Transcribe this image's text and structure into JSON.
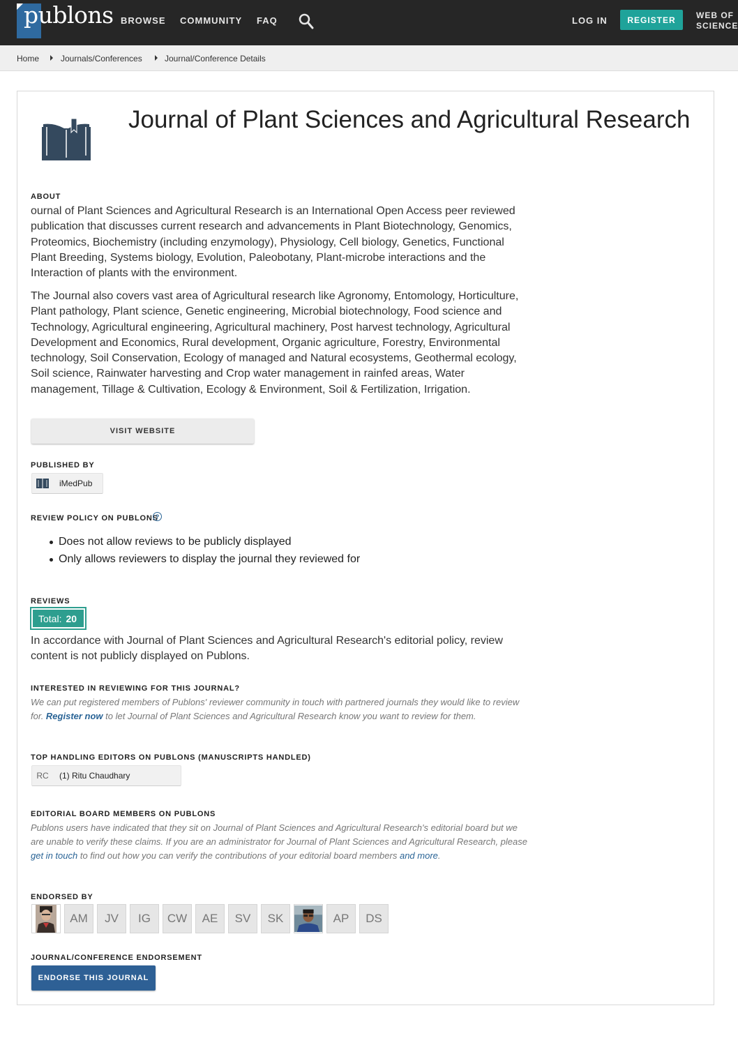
{
  "nav": {
    "logo": "publons",
    "browse": "BROWSE",
    "community": "COMMUNITY",
    "faq": "FAQ",
    "login": "LOG IN",
    "register": "REGISTER",
    "wos_line1": "WEB OF",
    "wos_line2": "SCIENCE"
  },
  "breadcrumb": {
    "home": "Home",
    "journals": "Journals/Conferences",
    "current": "Journal/Conference Details"
  },
  "journal": {
    "title": "Journal of Plant Sciences and Agricultural Research"
  },
  "about": {
    "label": "ABOUT",
    "para1": "ournal of Plant Sciences and Agricultural Research is an International Open Access peer reviewed publication that discusses current research and advancements in Plant Biotechnology, Genomics, Proteomics, Biochemistry (including enzymology), Physiology, Cell biology, Genetics, Functional Plant Breeding, Systems biology, Evolution, Paleobotany, Plant-microbe interactions and the Interaction of plants with the environment.",
    "para2": "The Journal also covers vast area of Agricultural research like Agronomy, Entomology, Horticulture, Plant pathology, Plant science, Genetic engineering, Microbial biotechnology, Food science and Technology, Agricultural engineering, Agricultural machinery, Post harvest technology, Agricultural Development and Economics, Rural development, Organic agriculture, Forestry, Environmental technology, Soil Conservation, Ecology of managed and Natural ecosystems, Geothermal ecology, Soil science, Rainwater harvesting and Crop water management in rainfed areas, Water management, Tillage & Cultivation, Ecology & Environment, Soil & Fertilization, Irrigation."
  },
  "visit_website": "VISIT WEBSITE",
  "published_by": {
    "label": "PUBLISHED BY",
    "publisher": "iMedPub"
  },
  "review_policy": {
    "label": "REVIEW POLICY ON PUBLONS",
    "help_glyph": "?",
    "items": [
      "Does not allow reviews to be publicly displayed",
      "Only allows reviewers to display the journal they reviewed for"
    ]
  },
  "reviews": {
    "label": "REVIEWS",
    "total_label": "Total:",
    "total_value": "20",
    "note": "In accordance with Journal of Plant Sciences and Agricultural Research's editorial policy, review content is not publicly displayed on Publons."
  },
  "interested": {
    "label": "INTERESTED IN REVIEWING FOR THIS JOURNAL?",
    "text_before": "We can put registered members of Publons' reviewer community in touch with partnered journals they would like to review for. ",
    "link": "Register now",
    "text_after": " to let Journal of Plant Sciences and Agricultural Research know you want to review for them."
  },
  "editors": {
    "label": "TOP HANDLING EDITORS ON PUBLONS (MANUSCRIPTS HANDLED)",
    "initials": "RC",
    "entry": "(1) Ritu Chaudhary"
  },
  "board": {
    "label": "EDITORIAL BOARD MEMBERS ON PUBLONS",
    "text_before": "Publons users have indicated that they sit on Journal of Plant Sciences and Agricultural Research's editorial board but we are unable to verify these claims. If you are an administrator for Journal of Plant Sciences and Agricultural Research, please ",
    "link1": "get in touch",
    "text_middle": " to find out how you can verify the contributions of your editorial board members ",
    "link2": "and more",
    "text_end": "."
  },
  "endorsed_by": {
    "label": "ENDORSED BY",
    "initials": [
      "AM",
      "JV",
      "IG",
      "CW",
      "AE",
      "SV",
      "SK",
      "AP",
      "DS"
    ]
  },
  "endorsement": {
    "label": "JOURNAL/CONFERENCE ENDORSEMENT",
    "button": "ENDORSE THIS JOURNAL"
  },
  "colors": {
    "nav_bg": "#262626",
    "brand_blue": "#2f6aa0",
    "register_teal": "#1fa39a",
    "badge_teal": "#2e9e8f",
    "endorse_blue": "#2e6095",
    "link_blue": "#2a6496"
  }
}
